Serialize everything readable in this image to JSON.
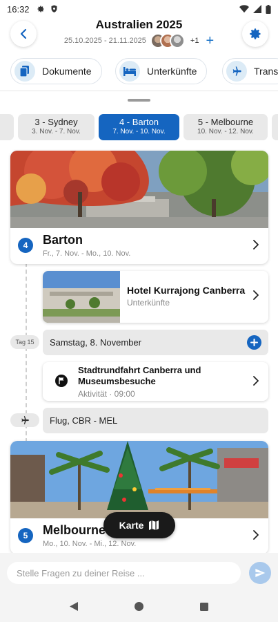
{
  "status_bar": {
    "time": "16:32"
  },
  "header": {
    "title": "Australien 2025",
    "date_range": "25.10.2025 - 21.11.2025",
    "extra_members": "+1"
  },
  "categories": [
    {
      "label": "Dokumente",
      "icon": "document-icon"
    },
    {
      "label": "Unterkünfte",
      "icon": "bed-icon"
    },
    {
      "label": "Trans",
      "icon": "plane-icon"
    }
  ],
  "stops": [
    {
      "name": "3 - Sydney",
      "dates": "3. Nov. - 7. Nov.",
      "active": false
    },
    {
      "name": "4 - Barton",
      "dates": "7. Nov. - 10. Nov.",
      "active": true
    },
    {
      "name": "5 - Melbourne",
      "dates": "10. Nov. - 12. Nov.",
      "active": false
    }
  ],
  "destinations": [
    {
      "number": "4",
      "name": "Barton",
      "dates": "Fr., 7. Nov. - Mo., 10. Nov."
    },
    {
      "number": "5",
      "name": "Melbourne",
      "dates": "Mo., 10. Nov. - Mi., 12. Nov."
    }
  ],
  "accommodation": {
    "name": "Hotel Kurrajong Canberra",
    "type": "Unterkünfte"
  },
  "day": {
    "tag": "Tag 15",
    "label": "Samstag, 8. November"
  },
  "activity": {
    "title": "Stadtrundfahrt Canberra und Museumsbesuche",
    "subtitle": "Aktivität · 09:00"
  },
  "transport": {
    "label": "Flug, CBR - MEL"
  },
  "map_button": {
    "label": "Karte"
  },
  "chat": {
    "placeholder": "Stelle Fragen zu deiner Reise ..."
  },
  "colors": {
    "accent": "#1565c0",
    "send_inactive": "#a9c9ec"
  }
}
